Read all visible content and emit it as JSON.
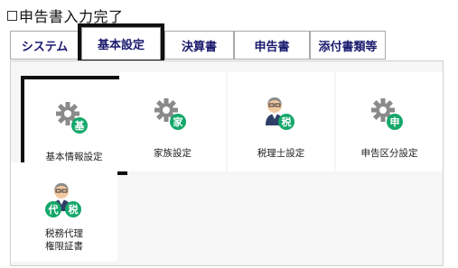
{
  "completion": {
    "label": "申告書入力完了",
    "checked": false
  },
  "tabs": [
    {
      "label": "システム",
      "active": false
    },
    {
      "label": "基本設定",
      "active": true
    },
    {
      "label": "決算書",
      "active": false
    },
    {
      "label": "申告書",
      "active": false
    },
    {
      "label": "添付書類等",
      "active": false
    }
  ],
  "tiles": [
    {
      "label": "基本情報設定",
      "icon": "gear-icon",
      "badge": "基",
      "highlighted": true
    },
    {
      "label": "家族設定",
      "icon": "gear-icon",
      "badge": "家",
      "highlighted": false
    },
    {
      "label": "税理士設定",
      "icon": "person-icon",
      "badge": "税",
      "highlighted": false
    },
    {
      "label": "申告区分設定",
      "icon": "gear-icon",
      "badge": "申",
      "highlighted": false
    },
    {
      "label_line1": "税務代理",
      "label_line2": "権限証書",
      "icon": "person-icon",
      "badges": [
        "代",
        "税"
      ],
      "highlighted": false
    }
  ],
  "colors": {
    "badge": "#15a86a",
    "tab_text": "#1a1a6e",
    "gear": "#8a8a8a"
  }
}
